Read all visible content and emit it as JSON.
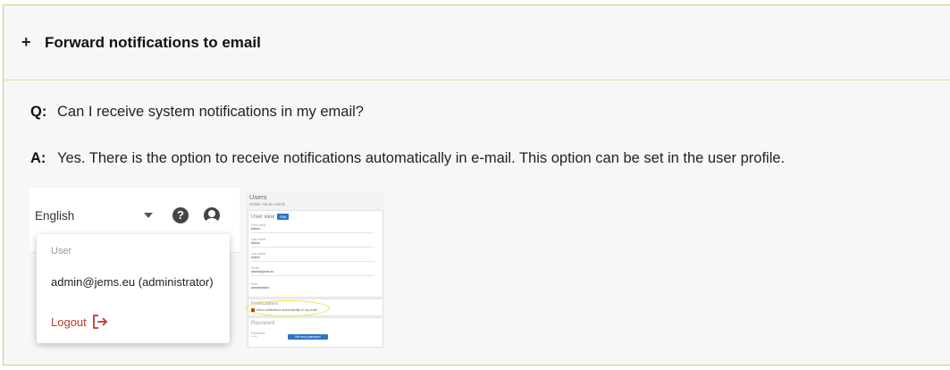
{
  "section": {
    "expand_icon": "+",
    "title": "Forward notifications to email"
  },
  "qa": {
    "q_tag": "Q:",
    "question": "Can I receive system notifications in my email?",
    "a_tag": "A:",
    "answer": "Yes. There is the option to receive notifications automatically in e-mail. This option can be set in the user profile."
  },
  "screenshot_menu": {
    "language": "English",
    "help_icon": "help-icon",
    "account_icon": "account-circle-icon",
    "menu_label": "User",
    "user": "admin@jems.eu (administrator)",
    "logout_label": "Logout",
    "logout_icon": "logout-arrow-icon",
    "accent_color": "#c0392b"
  },
  "screenshot_profile": {
    "title": "Users",
    "subtitle": "Detail: Admin Admin",
    "user_view_label": "User view",
    "edit_label": "Edit",
    "fields": [
      {
        "label": "First name",
        "value": "Admin"
      },
      {
        "label": "Last name",
        "value": "Admin"
      },
      {
        "label": "Last name",
        "value": "Admin"
      },
      {
        "label": "Email",
        "value": "admin@jems.eu"
      },
      {
        "label": "Role",
        "value": "administrator"
      }
    ],
    "notifications_label": "Notifications",
    "notifications_checkbox": "Send notifications automatically to my email",
    "password_label": "Password",
    "password_field_label": "Password",
    "password_field_value": "*****",
    "change_password_label": "Set new password",
    "button_color": "#2f73c9",
    "highlight_color": "#f0e04a"
  }
}
